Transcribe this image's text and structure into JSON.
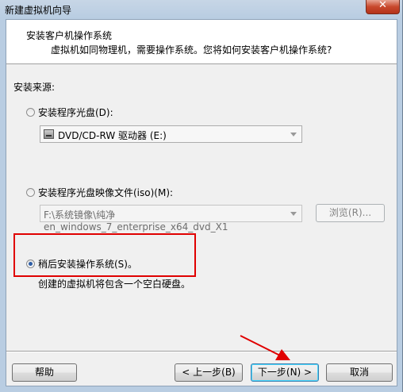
{
  "window": {
    "title": "新建虚拟机向导"
  },
  "header": {
    "title": "安装客户机操作系统",
    "subtitle": "虚拟机如同物理机，需要操作系统。您将如何安装客户机操作系统?"
  },
  "install_source_label": "安装来源:",
  "options": {
    "disc": {
      "label": "安装程序光盘(D):",
      "selected": false,
      "drive": "DVD/CD-RW 驱动器 (E:)"
    },
    "iso": {
      "label": "安装程序光盘映像文件(iso)(M):",
      "selected": false,
      "path": "F:\\系统镜像\\纯净en_windows_7_enterprise_x64_dvd_X1",
      "browse_label": "浏览(R)..."
    },
    "later": {
      "label": "稍后安装操作系统(S)。",
      "selected": true,
      "description": "创建的虚拟机将包含一个空白硬盘。"
    }
  },
  "buttons": {
    "help": "帮助",
    "back": "< 上一步(B)",
    "next": "下一步(N) >",
    "cancel": "取消"
  },
  "annotation_colors": {
    "highlight": "#e00000",
    "arrow": "#e00000"
  }
}
